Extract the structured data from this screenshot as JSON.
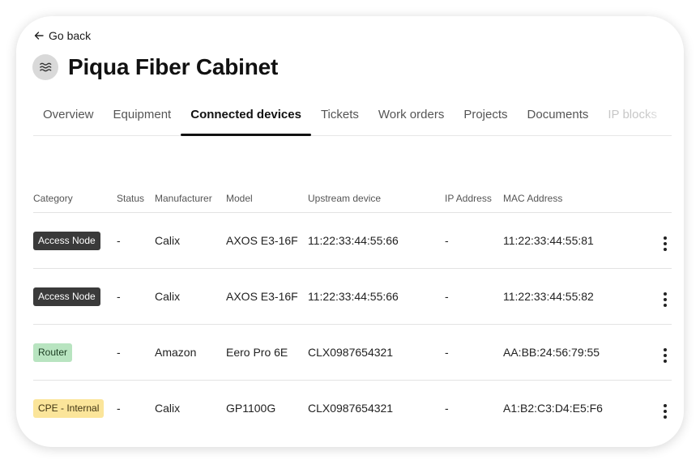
{
  "nav": {
    "back_label": "Go back"
  },
  "site": {
    "title": "Piqua Fiber Cabinet",
    "icon": "waves-icon"
  },
  "tabs": [
    {
      "label": "Overview",
      "active": false
    },
    {
      "label": "Equipment",
      "active": false
    },
    {
      "label": "Connected devices",
      "active": true
    },
    {
      "label": "Tickets",
      "active": false
    },
    {
      "label": "Work orders",
      "active": false
    },
    {
      "label": "Projects",
      "active": false
    },
    {
      "label": "Documents",
      "active": false
    },
    {
      "label": "IP blocks",
      "active": false
    }
  ],
  "table": {
    "headers": [
      "Category",
      "Status",
      "Manufacturer",
      "Model",
      "Upstream device",
      "IP Address",
      "MAC Address"
    ],
    "rows": [
      {
        "category": "Access Node",
        "status": "-",
        "manufacturer": "Calix",
        "model": "AXOS E3-16F",
        "upstream": "11:22:33:44:55:66",
        "ip": "-",
        "mac": "11:22:33:44:55:81"
      },
      {
        "category": "Access Node",
        "status": "-",
        "manufacturer": "Calix",
        "model": "AXOS E3-16F",
        "upstream": "11:22:33:44:55:66",
        "ip": "-",
        "mac": "11:22:33:44:55:82"
      },
      {
        "category": "Router",
        "status": "-",
        "manufacturer": "Amazon",
        "model": "Eero Pro 6E",
        "upstream": "CLX0987654321",
        "ip": "-",
        "mac": "AA:BB:24:56:79:55"
      },
      {
        "category": "CPE - Internal",
        "status": "-",
        "manufacturer": "Calix",
        "model": "GP1100G",
        "upstream": "CLX0987654321",
        "ip": "-",
        "mac": "A1:B2:C3:D4:E5:F6"
      }
    ]
  },
  "colors": {
    "access_node_badge": "#3a3a3a",
    "router_badge": "#b8e4c0",
    "cpe_badge": "#fbe59a"
  }
}
